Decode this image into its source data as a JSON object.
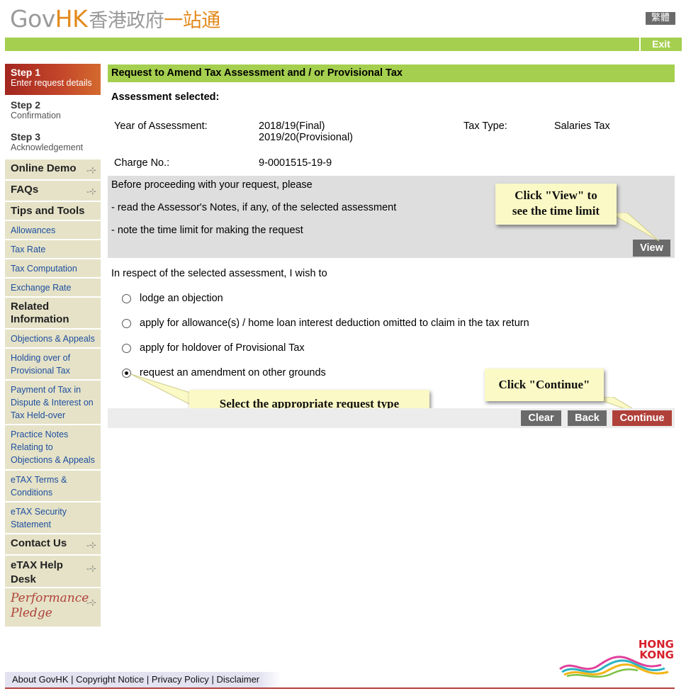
{
  "header": {
    "logo_gov": "Gov",
    "logo_hk": "HK",
    "logo_cn1": "香港政府",
    "logo_cn2": "一站通",
    "lang_label": "繁體",
    "exit_label": "Exit"
  },
  "sidebar": {
    "steps": [
      {
        "num": "Step 1",
        "desc": "Enter request details"
      },
      {
        "num": "Step 2",
        "desc": "Confirmation"
      },
      {
        "num": "Step 3",
        "desc": "Acknowledgement"
      }
    ],
    "online_demo": "Online Demo",
    "faqs": "FAQs",
    "tips_tools": "Tips and Tools",
    "tips_links": [
      "Allowances",
      "Tax Rate",
      "Tax Computation",
      "Exchange Rate"
    ],
    "related_info": "Related Information",
    "related_links": [
      "Objections & Appeals",
      "Holding over of Provisional Tax",
      "Payment of Tax in Dispute & Interest on Tax Held-over",
      "Practice Notes Relating to Objections & Appeals",
      "eTAX Terms & Conditions",
      "eTAX Security Statement"
    ],
    "contact_us": "Contact Us",
    "help_desk": "eTAX Help Desk",
    "pledge_line1": "Performance",
    "pledge_line2": "Pledge"
  },
  "main": {
    "title": "Request to Amend Tax Assessment and / or Provisional Tax",
    "assessment_selected": "Assessment selected:",
    "year_label": "Year of Assessment:",
    "year_value_1": "2018/19(Final)",
    "year_value_2": "2019/20(Provisional)",
    "tax_type_label": "Tax Type:",
    "tax_type_value": "Salaries Tax",
    "charge_label": "Charge No.:",
    "charge_value": "9-0001515-19-9",
    "notice_1": "Before proceeding with your request, please",
    "notice_2": "- read the Assessor's Notes, if any, of the selected assessment",
    "notice_3": "- note the time limit for making the request",
    "view_label": "View",
    "intro": "In respect of the selected assessment, I wish to",
    "options": [
      {
        "label": "lodge an objection",
        "selected": false
      },
      {
        "label": "apply for allowance(s) / home loan interest deduction omitted to claim in the tax return",
        "selected": false
      },
      {
        "label": "apply for holdover of Provisional Tax",
        "selected": false
      },
      {
        "label": "request an amendment on other grounds",
        "selected": true
      }
    ],
    "clear_label": "Clear",
    "back_label": "Back",
    "continue_label": "Continue"
  },
  "callouts": {
    "view_line1": "Click \"View\" to",
    "view_line2": "see the time limit",
    "request_type": "Select the appropriate request type",
    "continue": "Click \"Continue\""
  },
  "footer": {
    "about": "About GovHK",
    "copyright": "Copyright Notice",
    "privacy": "Privacy Policy",
    "disclaimer": "Disclaimer",
    "sep": "|",
    "brand_line1": "HONG",
    "brand_line2": "KONG"
  },
  "colors": {
    "green_bar": "#a5cf4f",
    "sidebar_bg": "#e5e2c7",
    "link_blue": "#1f4fa0",
    "continue_red": "#b0413a",
    "grey_button": "#6a6a6a",
    "callout_yellow": "#fbf9c5"
  }
}
